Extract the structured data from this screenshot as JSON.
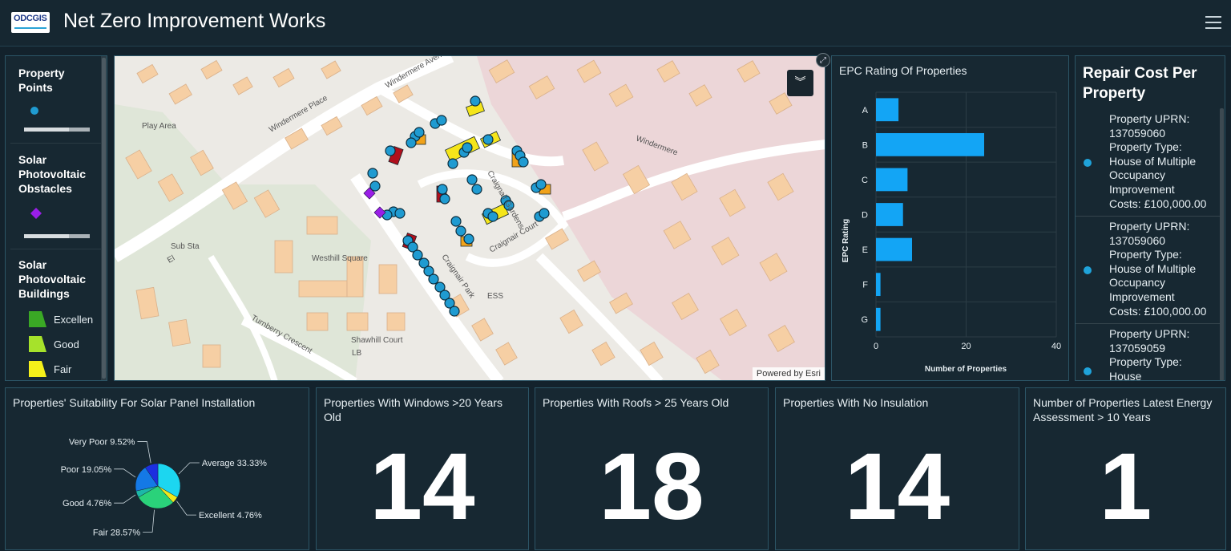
{
  "header": {
    "logo_text": "ODCGIS",
    "title": "Net Zero Improvement Works"
  },
  "legend": {
    "sections": [
      {
        "title_lines": [
          "Property",
          "Points"
        ]
      },
      {
        "title_lines": [
          "Solar",
          "Photovoltaic",
          "Obstacles"
        ]
      },
      {
        "title_lines": [
          "Solar",
          "Photovoltaic",
          "Buildings"
        ]
      }
    ],
    "building_classes": [
      {
        "label": "Excellen",
        "color": "#3aa825"
      },
      {
        "label": "Good",
        "color": "#a6e22b"
      },
      {
        "label": "Fair",
        "color": "#f5f01a"
      }
    ],
    "point_color": "#1f9bd1",
    "obstacle_color": "#9a1ee8"
  },
  "map": {
    "labels": [
      "Windermere Place",
      "Windermere Avenue",
      "Play Area",
      "Sub Sta",
      "El",
      "Westhill Square",
      "Craignair Gardens",
      "Craignair Court",
      "Craignair Park",
      "ESS",
      "Turnberry Crescent",
      "Shawhill Court",
      "LB",
      "Windermere"
    ],
    "attribution": "Powered by Esri"
  },
  "epc": {
    "title": "EPC Rating Of Properties",
    "chart_data": {
      "type": "bar",
      "orientation": "horizontal",
      "title": "EPC Rating Of Properties",
      "categories": [
        "A",
        "B",
        "C",
        "D",
        "E",
        "F",
        "G"
      ],
      "values": [
        5,
        24,
        7,
        6,
        8,
        1,
        1
      ],
      "xlabel": "Number of Properties",
      "ylabel": "EPC Rating",
      "xlim": [
        0,
        40
      ],
      "xticks": [
        0,
        20,
        40
      ],
      "color": "#13a5f5",
      "grid": true
    }
  },
  "repair": {
    "title_lines": [
      "Repair Cost Per",
      "Property"
    ],
    "items": [
      {
        "lines": [
          "Property UPRN:",
          "137059060",
          "Property Type:",
          "House of Multiple",
          "Occupancy",
          "Improvement",
          "Costs: £100,000.00"
        ]
      },
      {
        "lines": [
          "Property UPRN:",
          "137059060",
          "Property Type:",
          "House of Multiple",
          "Occupancy",
          "Improvement",
          "Costs: £100,000.00"
        ]
      },
      {
        "lines": [
          "Property UPRN:",
          "137059059",
          "Property Type:",
          "House"
        ]
      }
    ]
  },
  "suitability": {
    "title": "Properties' Suitability For Solar Panel Installation",
    "chart_data": {
      "type": "pie",
      "title": "Properties' Suitability For Solar Panel Installation",
      "slices": [
        {
          "label": "Average 33.33%",
          "value": 33.33,
          "color": "#1cd6f0"
        },
        {
          "label": "Excellent 4.76%",
          "value": 4.76,
          "color": "#f0e81c"
        },
        {
          "label": "Fair 28.57%",
          "value": 28.57,
          "color": "#2ad27a"
        },
        {
          "label": "Good 4.76%",
          "value": 4.76,
          "color": "#1cb8a8"
        },
        {
          "label": "Poor 19.05%",
          "value": 19.05,
          "color": "#1479e6"
        },
        {
          "label": "Very Poor 9.52%",
          "value": 9.52,
          "color": "#1c2fe0"
        }
      ]
    }
  },
  "kpis": [
    {
      "title": "Properties With Windows >20 Years Old",
      "value": "14"
    },
    {
      "title": "Properties With Roofs > 25 Years Old",
      "value": "18"
    },
    {
      "title": "Properties With No Insulation",
      "value": "14"
    },
    {
      "title": "Number of Properties Latest Energy Assessment > 10 Years",
      "value": "1"
    }
  ]
}
